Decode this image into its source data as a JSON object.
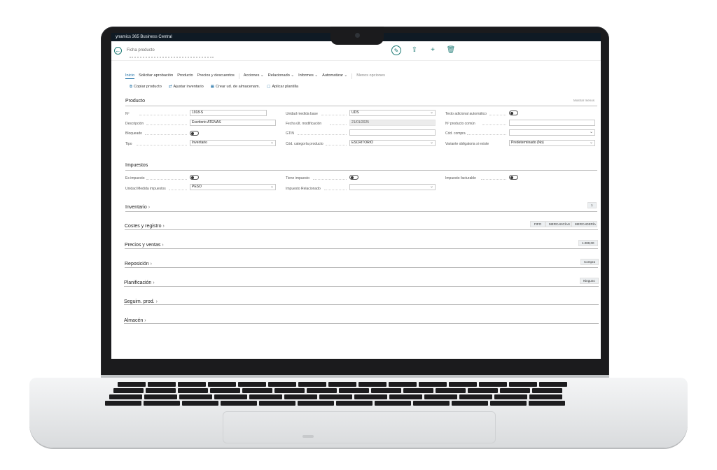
{
  "app": {
    "title": "ynamics 365 Business Central"
  },
  "nav": {
    "breadcrumb": "Ficha producto"
  },
  "menu": {
    "items": [
      "Inicio",
      "Solicitar aprobación",
      "Producto",
      "Precios y descuentos",
      "Acciones",
      "Relacionado",
      "Informes",
      "Automatizar",
      "Menos opciones"
    ]
  },
  "actions": [
    {
      "label": "Copiar producto",
      "icon": "copy-icon"
    },
    {
      "label": "Ajustar inventario",
      "icon": "adjust-icon"
    },
    {
      "label": "Crear ud. de almacenam.",
      "icon": "create-icon"
    },
    {
      "label": "Aplicar plantilla",
      "icon": "template-icon"
    }
  ],
  "producto": {
    "title": "Producto",
    "show_less": "Mostrar menos",
    "no_label": "Nº",
    "no_value": "1918-S",
    "descripcion_label": "Descripción",
    "descripcion_value": "Escritorio ATENAS",
    "bloqueado_label": "Bloqueado",
    "tipo_label": "Tipo",
    "tipo_value": "Inventario",
    "unidad_base_label": "Unidad medida base",
    "unidad_base_value": "UDS",
    "fecha_label": "Fecha últ. modificación",
    "fecha_value": "21/01/2025",
    "gtin_label": "GTIN",
    "categoria_label": "Cód. categoría producto",
    "categoria_value": "ESCRITORIO",
    "texto_label": "Texto adicional automático",
    "comun_label": "Nº producto común",
    "compra_label": "Cód. compra",
    "variante_label": "Variante obligatoria si existe",
    "variante_value": "Predeterminado (No)"
  },
  "impuestos": {
    "title": "Impuestos",
    "es_impuesto_label": "Es impuesto",
    "unidad_label": "Unidad Medida impuestos",
    "unidad_value": "PESO",
    "tiene_label": "Tiene impuesto",
    "relacionado_label": "Impuesto Relacionado",
    "facturable_label": "Impuesto facturable"
  },
  "fasttabs": {
    "inventario": "Inventario",
    "costes": "Costes y registro",
    "precios": "Precios y ventas",
    "reposicion": "Reposición",
    "planificacion": "Planificación",
    "seguimiento": "Seguim. prod.",
    "almacen": "Almacén"
  },
  "pills": {
    "inventario": "1",
    "costes_1": "FIFO",
    "costes_2": "MERCANCÍAS",
    "costes_3": "MERCADERÍA",
    "precios": "1.089,00",
    "reposicion": "Compra",
    "planificacion": "Ninguno"
  },
  "colors": {
    "accent": "#1d7a75",
    "link": "#1d6fa5",
    "titlebar": "#0f1a24"
  }
}
